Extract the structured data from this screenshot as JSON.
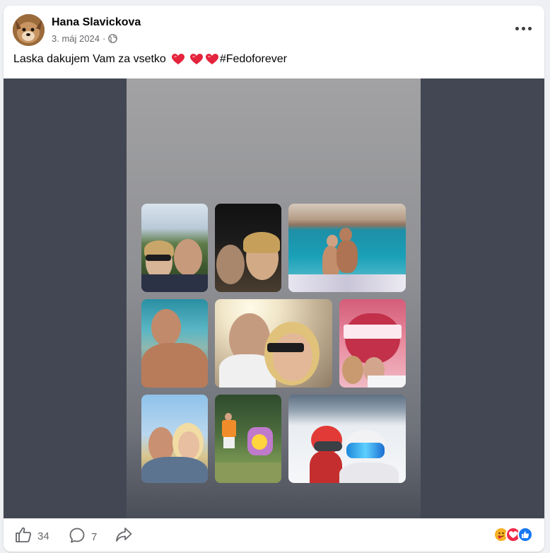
{
  "post": {
    "author": "Hana Slavickova",
    "date": "3. máj 2024",
    "separator": "·",
    "caption_text": "Laska dakujem Vam za vsetko",
    "hashtag": "#Fedoforever"
  },
  "icons": {
    "audience": "globe-icon",
    "menu": "more-options-icon",
    "caption_emojis": [
      "heart-icon",
      "heart-icon",
      "heart-icon"
    ]
  },
  "footer": {
    "like_count": "34",
    "comment_count": "7",
    "reactions": [
      "care-icon",
      "love-icon",
      "like-icon"
    ]
  },
  "colors": {
    "accent_blue": "#1877f2",
    "heart_red": "#e4233d",
    "media_bg": "#424753",
    "care_yellow": "#f7b125"
  },
  "media": {
    "photos": [
      "mountain-selfie",
      "night-selfie",
      "sea-boat-couple",
      "boat-man",
      "sunset-selfie",
      "kissing-point-heart",
      "sunny-selfie",
      "garden-man",
      "ski-selfie"
    ]
  }
}
